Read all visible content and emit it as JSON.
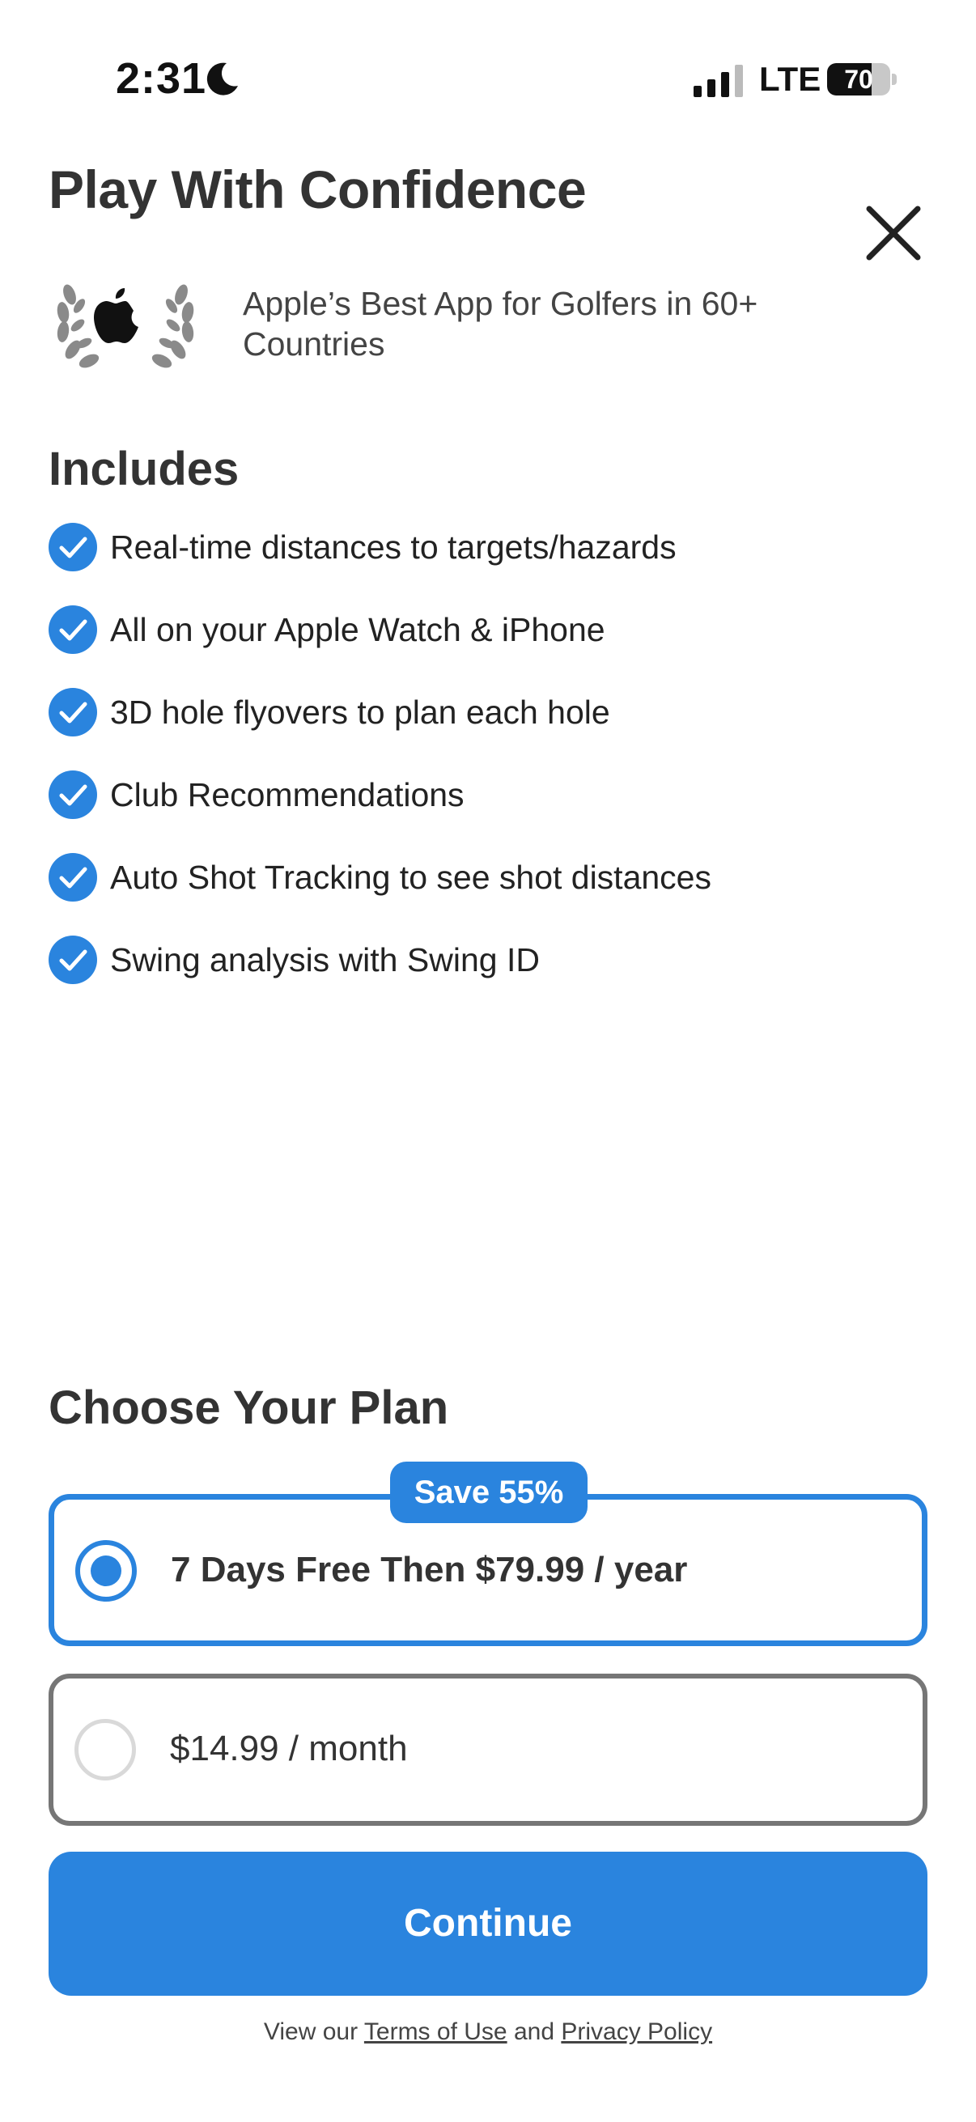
{
  "status_bar": {
    "time": "2:31",
    "network": "LTE",
    "battery_percent": "70",
    "battery_level": 0.7,
    "icons": [
      "moon-icon",
      "signal-icon",
      "battery-icon"
    ]
  },
  "header": {
    "title": "Play With Confidence",
    "close_icon": "close-icon"
  },
  "award": {
    "icon": "apple-laurel-icon",
    "text": "Apple’s Best App for Golfers in 60+ Countries"
  },
  "includes": {
    "title": "Includes",
    "items": [
      "Real-time distances to targets/hazards",
      "All on your Apple Watch & iPhone",
      "3D hole flyovers to plan each hole",
      "Club Recommendations",
      "Auto Shot Tracking to see shot distances",
      "Swing analysis with Swing ID"
    ]
  },
  "plans": {
    "title": "Choose Your Plan",
    "badge": "Save 55%",
    "options": [
      {
        "label": "7 Days Free Then $79.99 / year",
        "selected": true
      },
      {
        "label": "$14.99 / month",
        "selected": false
      }
    ]
  },
  "cta": {
    "label": "Continue"
  },
  "footer": {
    "prefix": "View our",
    "terms": "Terms of Use",
    "and": "and",
    "privacy": "Privacy Policy"
  },
  "colors": {
    "accent": "#2a84de",
    "text": "#333333",
    "unselected_border": "#767676"
  }
}
